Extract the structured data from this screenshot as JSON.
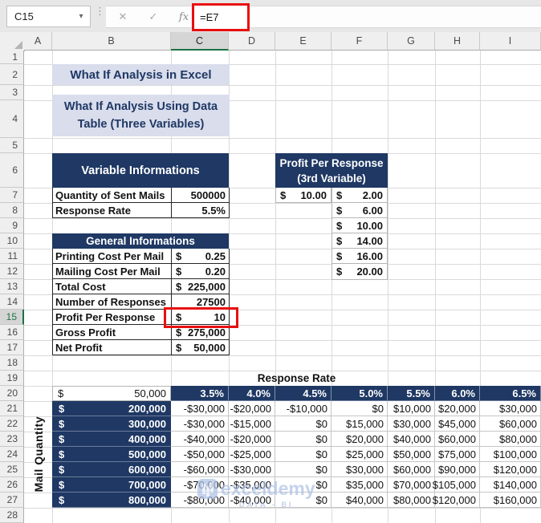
{
  "window": {
    "name_box": "C15",
    "formula": "=E7",
    "cancel_glyph": "✕",
    "enter_glyph": "✓",
    "fx_glyph": "fx",
    "caret_glyph": "▾",
    "dots_glyph": "⋮"
  },
  "grid": {
    "columns": [
      "A",
      "B",
      "C",
      "D",
      "E",
      "F",
      "G",
      "H",
      "I"
    ],
    "rows": [
      "1",
      "2",
      "3",
      "4",
      "5",
      "6",
      "7",
      "8",
      "9",
      "10",
      "11",
      "12",
      "13",
      "14",
      "15",
      "16",
      "17",
      "18",
      "19",
      "20",
      "21",
      "22",
      "23",
      "24",
      "25",
      "26",
      "27",
      "28"
    ],
    "selected_column": "C",
    "selected_row": "15"
  },
  "banners": {
    "title": "What If Analysis in Excel",
    "subtitle_lines": [
      "What If Analysis Using Data",
      "Table (Three Variables)"
    ]
  },
  "variable_info": {
    "header": "Variable Informations",
    "rows": [
      {
        "label": "Quantity of Sent Mails",
        "value": "500000"
      },
      {
        "label": "Response Rate",
        "value": "5.5%"
      }
    ]
  },
  "third_variable": {
    "header_lines": [
      "Profit Per Response",
      "(3rd Variable)"
    ],
    "selected": {
      "sym": "$",
      "val": "10.00"
    },
    "options": [
      {
        "sym": "$",
        "val": "2.00"
      },
      {
        "sym": "$",
        "val": "6.00"
      },
      {
        "sym": "$",
        "val": "10.00"
      },
      {
        "sym": "$",
        "val": "14.00"
      },
      {
        "sym": "$",
        "val": "16.00"
      },
      {
        "sym": "$",
        "val": "20.00"
      }
    ]
  },
  "general_info": {
    "header": "General Informations",
    "rows": [
      {
        "label": "Printing Cost Per Mail",
        "sym": "$",
        "val": "0.25"
      },
      {
        "label": "Mailing Cost Per Mail",
        "sym": "$",
        "val": "0.20"
      },
      {
        "label": "Total Cost",
        "sym": "$",
        "val": "225,000"
      },
      {
        "label": "Number of Responses",
        "sym": "",
        "val": "27500"
      },
      {
        "label": "Profit Per Response",
        "sym": "$",
        "val": "10"
      },
      {
        "label": "Gross Profit",
        "sym": "$",
        "val": "275,000"
      },
      {
        "label": "Net Profit",
        "sym": "$",
        "val": "50,000"
      }
    ]
  },
  "data_table": {
    "title": "Response Rate",
    "row_axis_label": "Mail Quantity",
    "corner": {
      "sym": "$",
      "val": "50,000"
    },
    "rate_headers": [
      "3.5%",
      "4.0%",
      "4.5%",
      "5.0%",
      "5.5%",
      "6.0%",
      "6.5%"
    ],
    "quantity_rows": [
      {
        "sym": "$",
        "qty": "200,000",
        "values": [
          "-$30,000",
          "-$20,000",
          "-$10,000",
          "$0",
          "$10,000",
          "$20,000",
          "$30,000"
        ]
      },
      {
        "sym": "$",
        "qty": "300,000",
        "values": [
          "-$30,000",
          "-$15,000",
          "$0",
          "$15,000",
          "$30,000",
          "$45,000",
          "$60,000"
        ]
      },
      {
        "sym": "$",
        "qty": "400,000",
        "values": [
          "-$40,000",
          "-$20,000",
          "$0",
          "$20,000",
          "$40,000",
          "$60,000",
          "$80,000"
        ]
      },
      {
        "sym": "$",
        "qty": "500,000",
        "values": [
          "-$50,000",
          "-$25,000",
          "$0",
          "$25,000",
          "$50,000",
          "$75,000",
          "$100,000"
        ]
      },
      {
        "sym": "$",
        "qty": "600,000",
        "values": [
          "-$60,000",
          "-$30,000",
          "$0",
          "$30,000",
          "$60,000",
          "$90,000",
          "$120,000"
        ]
      },
      {
        "sym": "$",
        "qty": "700,000",
        "values": [
          "-$70,000",
          "-$35,000",
          "$0",
          "$35,000",
          "$70,000",
          "$105,000",
          "$140,000"
        ]
      },
      {
        "sym": "$",
        "qty": "800,000",
        "values": [
          "-$80,000",
          "-$40,000",
          "$0",
          "$40,000",
          "$80,000",
          "$120,000",
          "$160,000"
        ]
      }
    ]
  },
  "watermark": {
    "brand": "exceldemy",
    "tagline": "DATA - BI"
  },
  "colors": {
    "navy": "#1F3864",
    "banner_bg": "#D9DDEC",
    "accent_green": "#1E7145",
    "annotation_red": "#E90F0F"
  }
}
